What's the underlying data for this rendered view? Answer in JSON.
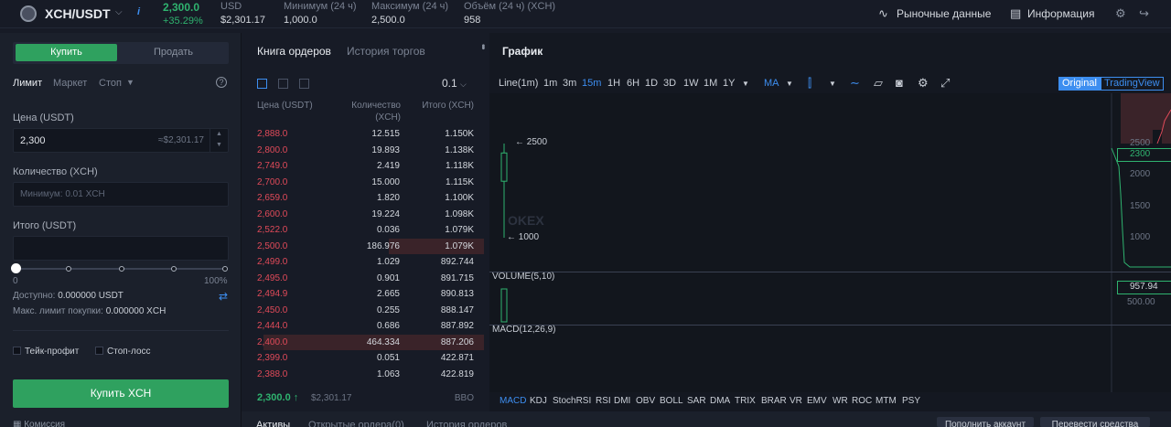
{
  "header": {
    "pair": "XCH/USDT",
    "info_label": "i",
    "last_price": "2,300.0",
    "change": "+35.29%",
    "stats": [
      {
        "label": "USD",
        "value": "$2,301.17"
      },
      {
        "label": "Минимум (24 ч)",
        "value": "1,000.0"
      },
      {
        "label": "Максимум (24 ч)",
        "value": "2,500.0"
      },
      {
        "label": "Объём (24 ч) (XCH)",
        "value": "958"
      }
    ],
    "market_data_label": "Рыночные данные",
    "information_label": "Информация"
  },
  "trade_form": {
    "buy_tab": "Купить",
    "sell_tab": "Продать",
    "order_types": [
      "Лимит",
      "Маркет",
      "Стоп"
    ],
    "price_label": "Цена (USDT)",
    "price_value": "2,300",
    "price_usd_hint": "≈$2,301.17",
    "amount_label": "Количество (XCH)",
    "amount_placeholder": "Минимум: 0.01 XCH",
    "total_label": "Итого (USDT)",
    "slider_min": "0",
    "slider_max": "100%",
    "slider_percent": 0,
    "available_label": "Доступно:",
    "available_value": "0.000000 USDT",
    "max_buy_label": "Макс. лимит покупки:",
    "max_buy_value": "0.000000 XCH",
    "take_profit_label": "Тейк-профит",
    "stop_loss_label": "Стоп-лосс",
    "buy_button": "Купить XCH",
    "commission_label": "Комиссия"
  },
  "orderbook": {
    "tab_book": "Книга ордеров",
    "tab_history": "История торгов",
    "step": "0.1",
    "col_price": "Цена (USDT)",
    "col_qty": "Количество (XCH)",
    "col_total": "Итого (XCH)",
    "rows": [
      {
        "price": "2,888.0",
        "qty": "12.515",
        "total": "1.150K",
        "depth": 0
      },
      {
        "price": "2,800.0",
        "qty": "19.893",
        "total": "1.138K",
        "depth": 0
      },
      {
        "price": "2,749.0",
        "qty": "2.419",
        "total": "1.118K",
        "depth": 0
      },
      {
        "price": "2,700.0",
        "qty": "15.000",
        "total": "1.115K",
        "depth": 0
      },
      {
        "price": "2,659.0",
        "qty": "1.820",
        "total": "1.100K",
        "depth": 0
      },
      {
        "price": "2,600.0",
        "qty": "19.224",
        "total": "1.098K",
        "depth": 0
      },
      {
        "price": "2,522.0",
        "qty": "0.036",
        "total": "1.079K",
        "depth": 0
      },
      {
        "price": "2,500.0",
        "qty": "186.976",
        "total": "1.079K",
        "depth": 0.4
      },
      {
        "price": "2,499.0",
        "qty": "1.029",
        "total": "892.744",
        "depth": 0
      },
      {
        "price": "2,495.0",
        "qty": "0.901",
        "total": "891.715",
        "depth": 0
      },
      {
        "price": "2,494.9",
        "qty": "2.665",
        "total": "890.813",
        "depth": 0
      },
      {
        "price": "2,450.0",
        "qty": "0.255",
        "total": "888.147",
        "depth": 0
      },
      {
        "price": "2,444.0",
        "qty": "0.686",
        "total": "887.892",
        "depth": 0
      },
      {
        "price": "2,400.0",
        "qty": "464.334",
        "total": "887.206",
        "depth": 0.93
      },
      {
        "price": "2,399.0",
        "qty": "0.051",
        "total": "422.871",
        "depth": 0
      },
      {
        "price": "2,388.0",
        "qty": "1.063",
        "total": "422.819",
        "depth": 0
      }
    ],
    "last_price": "2,300.0 ↑",
    "last_usd": "$2,301.17",
    "more_label": "BBO"
  },
  "chart": {
    "title": "График",
    "timeframes": [
      "Line(1m)",
      "1m",
      "3m",
      "15m",
      "1H",
      "6H",
      "1D",
      "3D",
      "1W",
      "1M",
      "1Y"
    ],
    "active_timeframe": "15m",
    "ma_label": "MA",
    "mode_original": "Original",
    "mode_tradingview": "TradingView",
    "high_marker": "← 2500",
    "low_marker": "← 1000",
    "volume_label": "VOLUME(5,10)",
    "macd_label": "MACD(12,26,9)",
    "watermark": "OKEX",
    "price_axis": [
      "2500",
      "2000",
      "1500",
      "1000"
    ],
    "current_price": "2300",
    "volume_axis": "500.00",
    "volume_badge": "957.94",
    "indicators": [
      "MACD",
      "KDJ",
      "StochRSI",
      "RSI",
      "DMI",
      "OBV",
      "BOLL",
      "SAR",
      "DMA",
      "TRIX",
      "BRAR",
      "VR",
      "EMV",
      "WR",
      "ROC",
      "MTM",
      "PSY"
    ],
    "active_indicator": "MACD"
  },
  "bottom": {
    "tabs": [
      "Активы",
      "Открытые ордера(0)",
      "История ордеров"
    ],
    "buttons": [
      "Пополнить аккаунт",
      "Перевести средства"
    ]
  },
  "colors": {
    "accent": "#3d8ef0",
    "buy": "#2fa15f",
    "sell": "#e04a59"
  }
}
